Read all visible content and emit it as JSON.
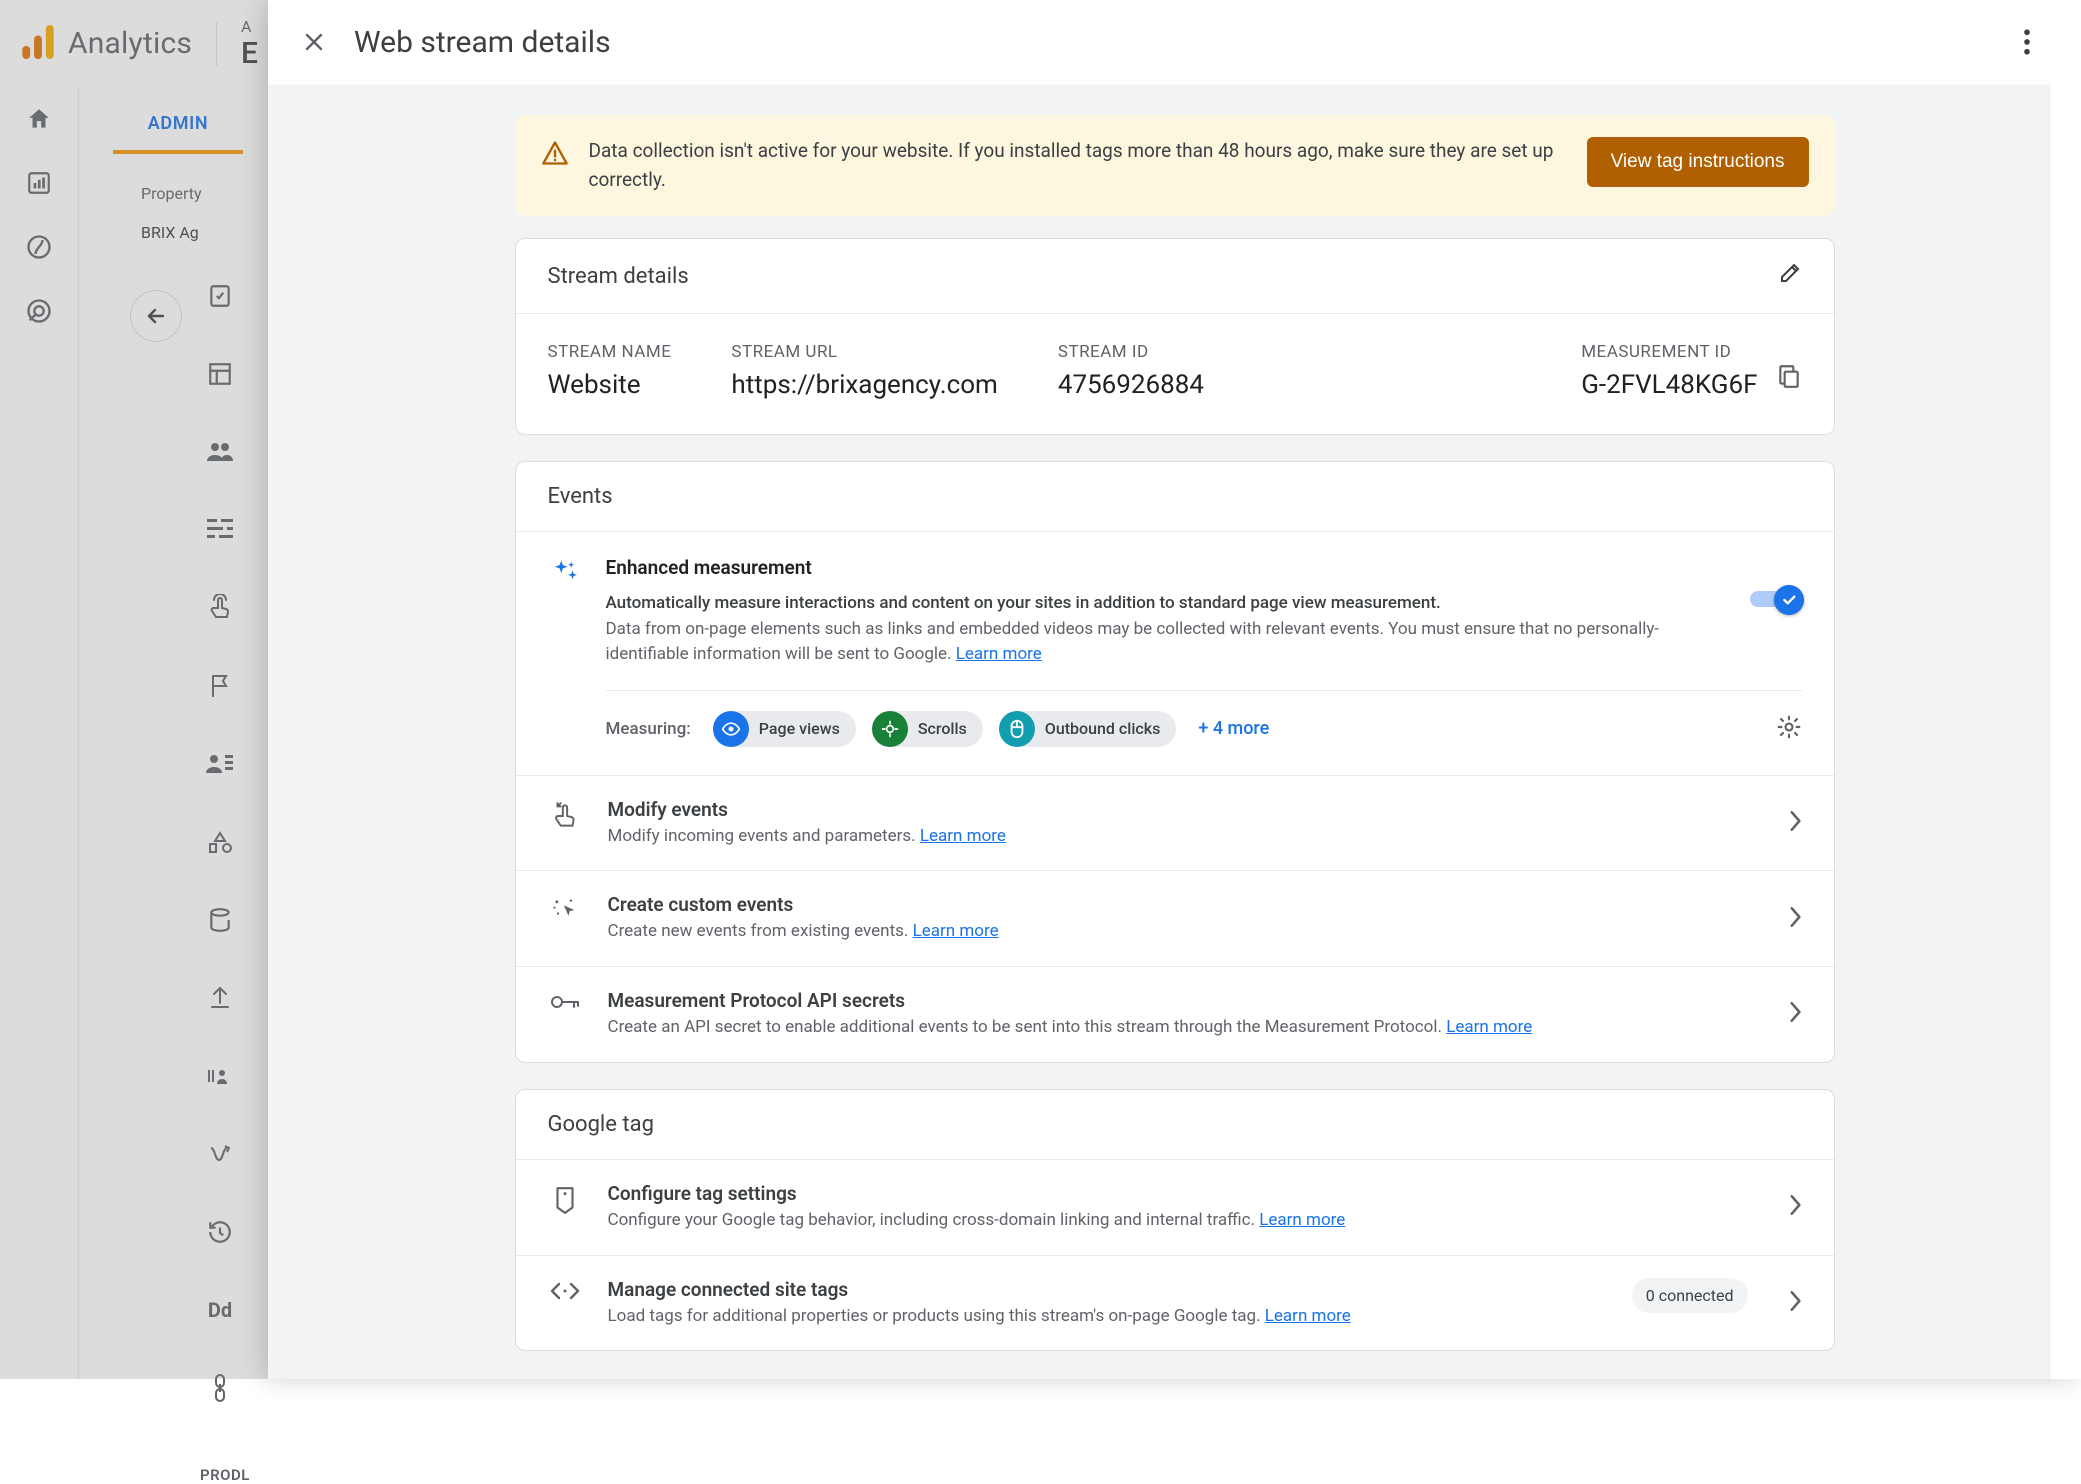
{
  "bg": {
    "brand": "Analytics",
    "prop_label": "A",
    "prop_value": "E",
    "admin_tab": "ADMIN",
    "property_label": "Property",
    "property_value": "BRIX Ag",
    "produ": "PRODL"
  },
  "panel": {
    "title": "Web stream details"
  },
  "warning": {
    "text": "Data collection isn't active for your website. If you installed tags more than 48 hours ago, make sure they are set up correctly.",
    "cta": "View tag instructions"
  },
  "stream_details": {
    "header": "Stream details",
    "name_label": "STREAM NAME",
    "name_value": "Website",
    "url_label": "STREAM URL",
    "url_value": "https://brixagency.com",
    "id_label": "STREAM ID",
    "id_value": "4756926884",
    "mid_label": "MEASUREMENT ID",
    "mid_value": "G-2FVL48KG6F"
  },
  "events": {
    "header": "Events",
    "enhanced": {
      "title": "Enhanced measurement",
      "desc_strong": "Automatically measure interactions and content on your sites in addition to standard page view measurement.",
      "desc_rest": "Data from on-page elements such as links and embedded videos may be collected with relevant events. You must ensure that no personally-identifiable information will be sent to Google. ",
      "learn": "Learn more",
      "measuring_label": "Measuring:",
      "chips": [
        "Page views",
        "Scrolls",
        "Outbound clicks"
      ],
      "more": "+ 4 more"
    },
    "modify": {
      "title": "Modify events",
      "desc": "Modify incoming events and parameters. ",
      "learn": "Learn more"
    },
    "create": {
      "title": "Create custom events",
      "desc": "Create new events from existing events. ",
      "learn": "Learn more"
    },
    "mp": {
      "title": "Measurement Protocol API secrets",
      "desc": "Create an API secret to enable additional events to be sent into this stream through the Measurement Protocol. ",
      "learn": "Learn more"
    }
  },
  "gtag": {
    "header": "Google tag",
    "configure": {
      "title": "Configure tag settings",
      "desc": "Configure your Google tag behavior, including cross-domain linking and internal traffic. ",
      "learn": "Learn more"
    },
    "connected": {
      "title": "Manage connected site tags",
      "desc": "Load tags for additional properties or products using this stream's on-page Google tag. ",
      "learn": "Learn more",
      "badge": "0 connected"
    }
  }
}
